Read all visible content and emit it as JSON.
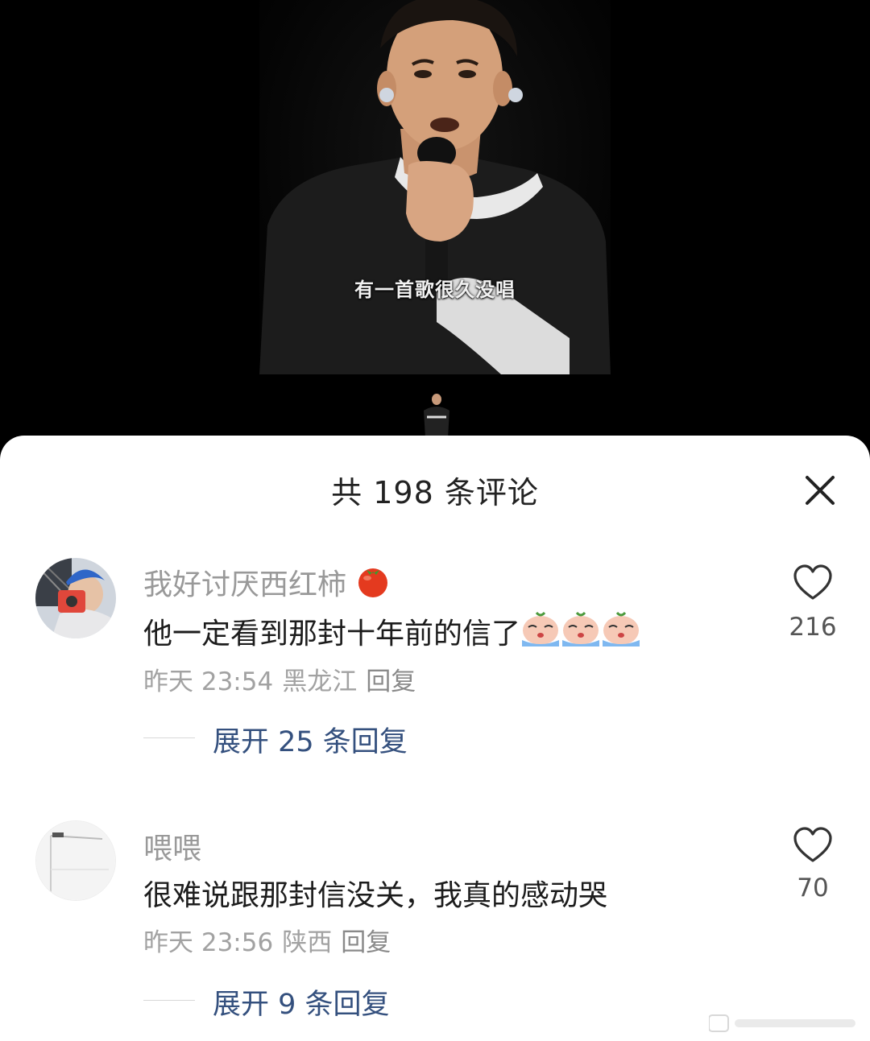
{
  "video": {
    "subtitle": "有一首歌很久没唱"
  },
  "sheet": {
    "title": "共 198 条评论",
    "close_icon": "close-icon"
  },
  "comments": [
    {
      "username": "我好讨厌西红柿",
      "username_emoji": "tomato-icon",
      "text": "他一定看到那封十年前的信了",
      "text_emojis": [
        "crying-emoji",
        "crying-emoji",
        "crying-emoji"
      ],
      "time": "昨天 23:54",
      "location": "黑龙江",
      "reply_label": "回复",
      "expand_label": "展开 25 条回复",
      "likes": "216"
    },
    {
      "username": "喂喂",
      "text": "很难说跟那封信没关，我真的感动哭",
      "time": "昨天 23:56",
      "location": "陕西",
      "reply_label": "回复",
      "expand_label": "展开 9 条回复",
      "likes": "70"
    }
  ],
  "colors": {
    "link": "#34507e",
    "muted": "#999999",
    "text": "#1c1c1c"
  }
}
